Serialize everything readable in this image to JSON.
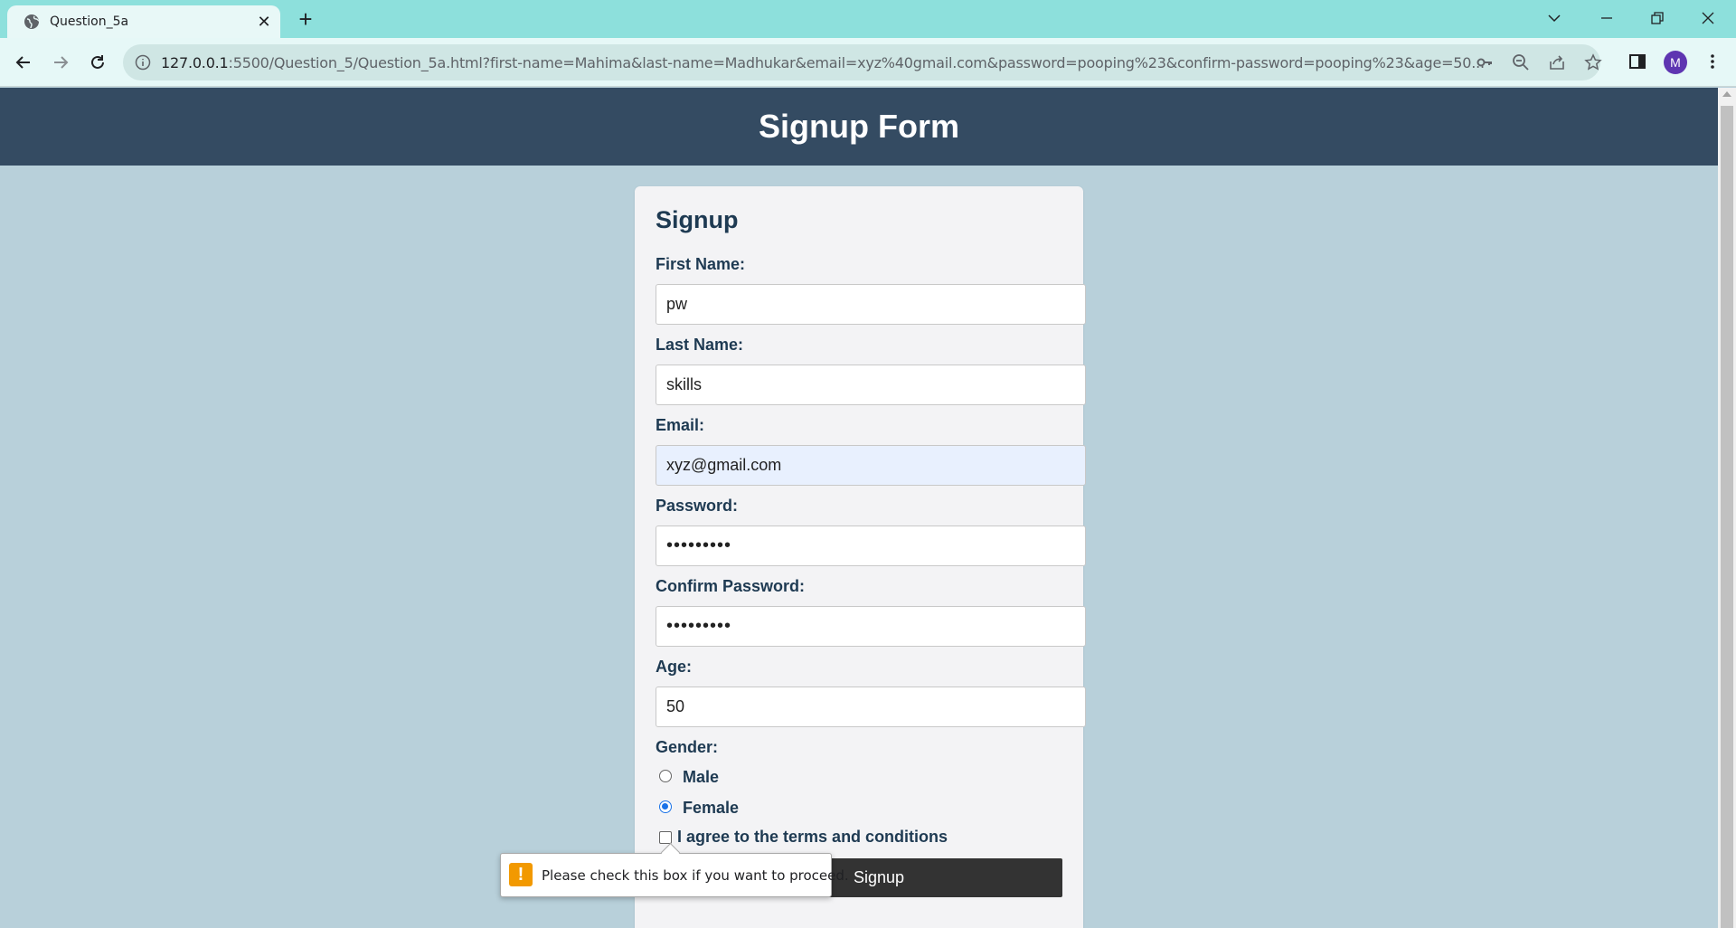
{
  "browser": {
    "tab_title": "Question_5a",
    "url_host": "127.0.0.1",
    "url_rest": ":5500/Question_5/Question_5a.html?first-name=Mahima&last-name=Madhukar&email=xyz%40gmail.com&password=pooping%23&confirm-password=pooping%23&age=50...",
    "avatar_letter": "M",
    "avatar_color": "#5e35b1"
  },
  "page": {
    "header_title": "Signup Form",
    "header_bg": "#344b62",
    "background": "#b8d0da"
  },
  "form": {
    "title": "Signup",
    "first_name_label": "First Name:",
    "first_name_value": "pw",
    "last_name_label": "Last Name:",
    "last_name_value": "skills",
    "email_label": "Email:",
    "email_value": "xyz@gmail.com",
    "password_label": "Password:",
    "password_value": "•••••••••",
    "confirm_password_label": "Confirm Password:",
    "confirm_password_value": "•••••••••",
    "age_label": "Age:",
    "age_value": "50",
    "gender_label": "Gender:",
    "gender_options": [
      {
        "label": "Male",
        "checked": false
      },
      {
        "label": "Female",
        "checked": true
      }
    ],
    "terms_label": "I agree to the terms and conditions",
    "terms_checked": false,
    "submit_label": "Signup"
  },
  "tooltip": {
    "icon": "warning-icon",
    "message": "Please check this box if you want to proceed."
  }
}
